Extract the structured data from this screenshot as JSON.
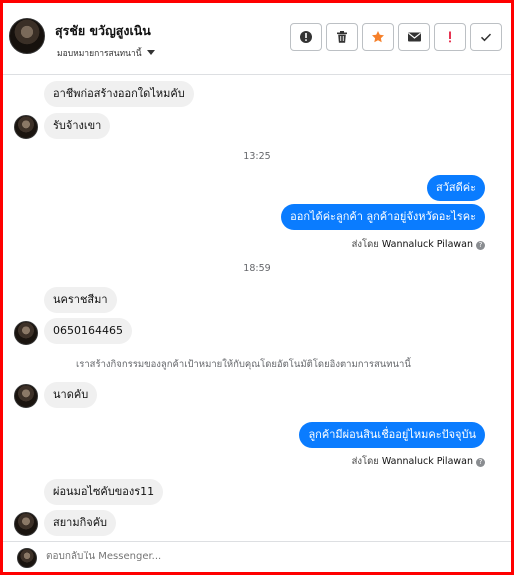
{
  "header": {
    "contact_name": "สุรชัย ขวัญสูงเนิน",
    "assign_label": "มอบหมายการสนทนานี้",
    "actions": [
      "info-icon",
      "trash-icon",
      "star-icon",
      "mail-icon",
      "exclamation-icon",
      "check-icon"
    ],
    "star_color": "#f6802a",
    "alert_color": "#e41e3f"
  },
  "thread": {
    "msg1": "อาชีพก่อสร้างออกใดไหมคับ",
    "msg2": "รับจ้างเขา",
    "time1": "13:25",
    "out1": "สวัสดีค่ะ",
    "out2": "ออกได้ค่ะลูกค้า  ลูกค้าอยู่จังหวัดอะไรคะ",
    "sent_by_prefix": "ส่งโดย",
    "sent_by_name": "Wannaluck Pilawan",
    "time2": "18:59",
    "msg3": "นคราชสีมา",
    "msg4": "0650164465",
    "system_note": "เราสร้างกิจกรรมของลูกค้าเป้าหมายให้กับคุณโดยอัตโนมัติโดยอิงตามการสนทนานี้",
    "msg5": "นาดคับ",
    "out3": "ลูกค้ามีผ่อนสินเชื่ออยู่ไหมคะปัจจุบัน",
    "msg6": "ผ่อนมอไซคับของร11",
    "msg7": "สยามกิจคับ",
    "outgoing_color": "#0a7cff"
  },
  "composer": {
    "placeholder": "ตอบกลับใน Messenger..."
  }
}
